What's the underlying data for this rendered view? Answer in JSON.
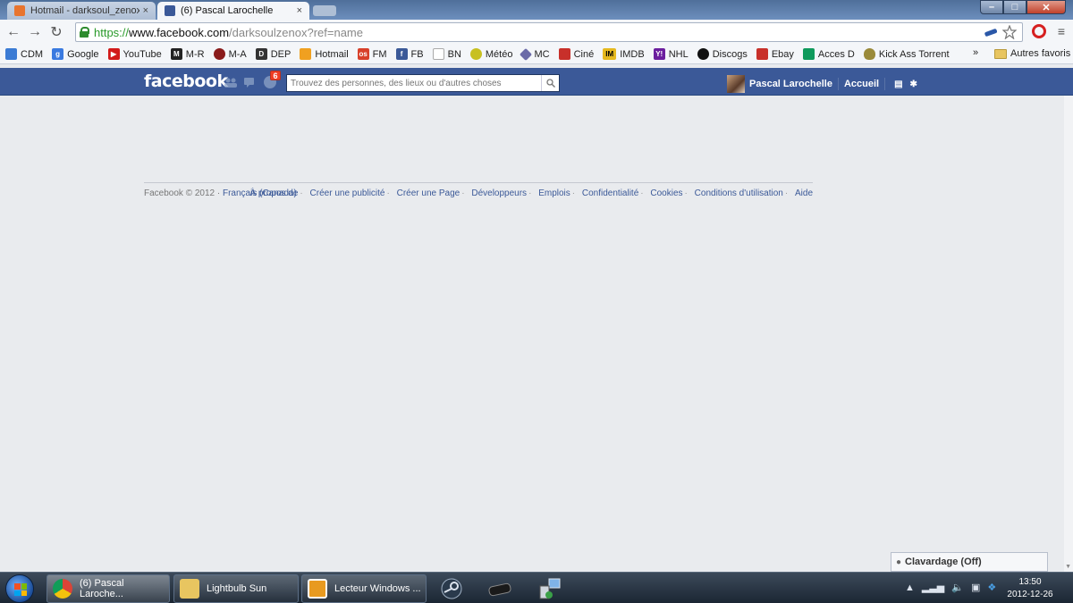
{
  "browser": {
    "tabs": [
      {
        "label": "Hotmail - darksoul_zenox",
        "close": "×",
        "favicon": "hotmail-icon",
        "active": false
      },
      {
        "label": "(6) Pascal Larochelle",
        "close": "×",
        "favicon": "facebook-icon",
        "active": true
      }
    ],
    "url": {
      "scheme": "https://",
      "host": "www.facebook.com",
      "path": "/darksoulzenox?ref=name"
    },
    "bookmarks": [
      "CDM",
      "Google",
      "YouTube",
      "M-R",
      "M-A",
      "DEP",
      "Hotmail",
      "FM",
      "FB",
      "BN",
      "Météo",
      "MC",
      "Ciné",
      "IMDB",
      "NHL",
      "Discogs",
      "Ebay",
      "Acces D",
      "Kick Ass Torrent"
    ],
    "bookmarks_more": "»",
    "other_bookmarks": "Autres favoris"
  },
  "facebook": {
    "logo": "facebook",
    "notification_count": "6",
    "search_placeholder": "Trouvez des personnes, des lieux ou d'autres choses",
    "user_name": "Pascal Larochelle",
    "home_label": "Accueil",
    "footer": {
      "copyright": "Facebook © 2012 ·",
      "language": "Français (Canada)",
      "links": [
        "À propos de",
        "Créer une publicité",
        "Créer une Page",
        "Développeurs",
        "Emplois",
        "Confidentialité",
        "Cookies",
        "Conditions d'utilisation",
        "Aide"
      ]
    },
    "chat_label": "Clavardage (Off)"
  },
  "taskbar": {
    "tasks": [
      "(6) Pascal Laroche...",
      "Lightbulb Sun",
      "Lecteur Windows ..."
    ],
    "time": "13:50",
    "date": "2012-12-26"
  },
  "colors": {
    "facebook_blue": "#3b5998",
    "accent_green": "#2a9a2a"
  }
}
